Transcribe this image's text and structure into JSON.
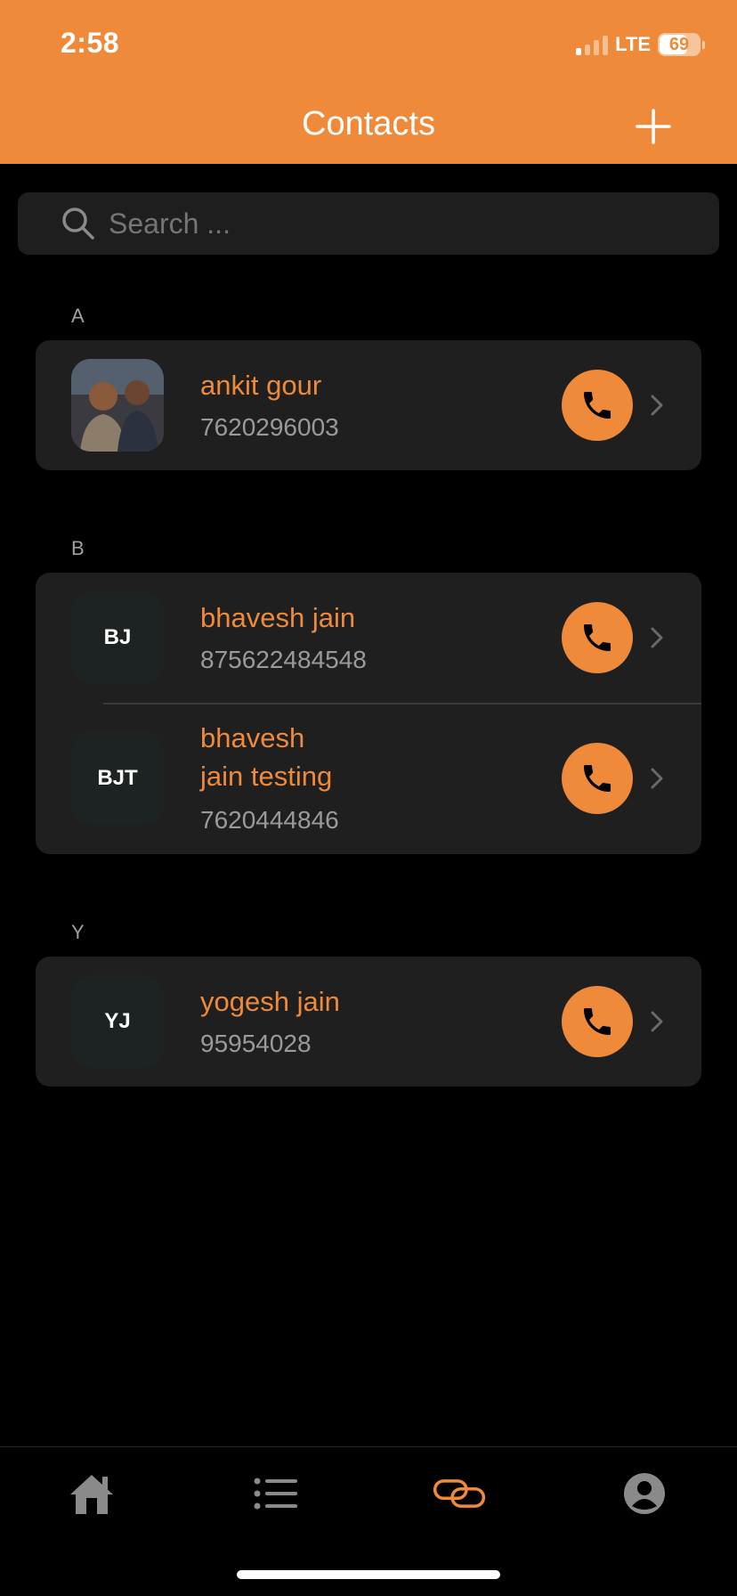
{
  "status_bar": {
    "time": "2:58",
    "network": "LTE",
    "battery": "69"
  },
  "header": {
    "title": "Contacts",
    "add_icon": "plus-icon"
  },
  "search": {
    "placeholder": "Search ...",
    "icon": "search-icon"
  },
  "sections": [
    {
      "letter": "A",
      "contacts": [
        {
          "name": "ankit gour",
          "phone": "7620296003",
          "avatar": "photo"
        }
      ]
    },
    {
      "letter": "B",
      "contacts": [
        {
          "name": "bhavesh jain",
          "phone": "875622484548",
          "initials": "BJ"
        },
        {
          "name_line1": "bhavesh",
          "name_line2": "jain testing",
          "phone": "7620444846",
          "initials": "BJT"
        }
      ]
    },
    {
      "letter": "Y",
      "contacts": [
        {
          "name": "yogesh jain",
          "phone": "95954028",
          "initials": "YJ"
        }
      ]
    }
  ],
  "tab_bar": {
    "items": [
      "home-icon",
      "list-icon",
      "link-icon",
      "profile-icon"
    ],
    "active": "link-icon"
  },
  "colors": {
    "accent": "#EE8A3A",
    "background": "#000000",
    "card": "#1F1F1F"
  }
}
